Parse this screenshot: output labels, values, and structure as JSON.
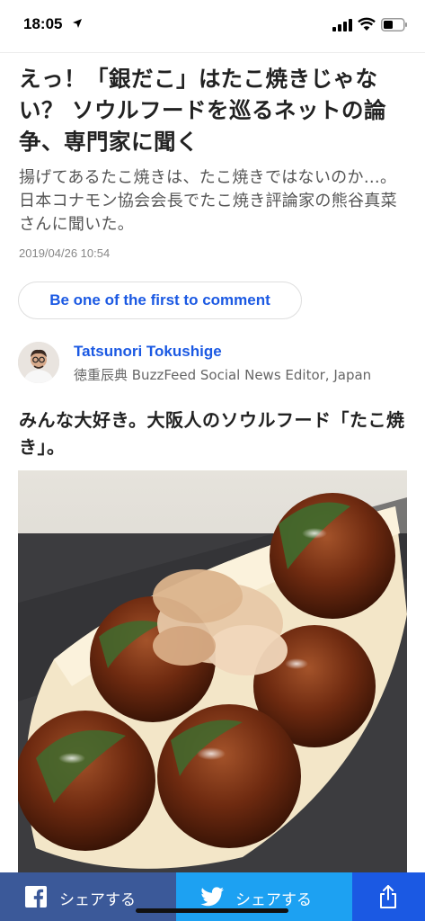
{
  "status_bar": {
    "time": "18:05",
    "icons": [
      "location-arrow-icon",
      "signal-icon",
      "wifi-icon",
      "battery-icon"
    ]
  },
  "article": {
    "headline": "えっ！「銀だこ」はたこ焼きじゃない？ ソウルフードを巡るネットの論争、専門家に聞く",
    "dek": "揚げてあるたこ焼きは、たこ焼きではないのか…。日本コナモン協会会長でたこ焼き評論家の熊谷真菜さんに聞いた。",
    "timestamp": "2019/04/26 10:54",
    "comment_button": "Be one of the first to comment",
    "author": {
      "name": "Tatsunori Tokushige",
      "title": "徳重辰典 BuzzFeed Social News Editor, Japan"
    },
    "subheading": "みんな大好き。大阪人のソウルフード「たこ焼き」。",
    "image_subject": "takoyaki-photo"
  },
  "share_bar": {
    "facebook_label": "シェアする",
    "twitter_label": "シェアする",
    "more_icon": "share-icon"
  },
  "colors": {
    "link_blue": "#1b59e3",
    "facebook": "#3b5999",
    "twitter": "#1da1f2"
  }
}
